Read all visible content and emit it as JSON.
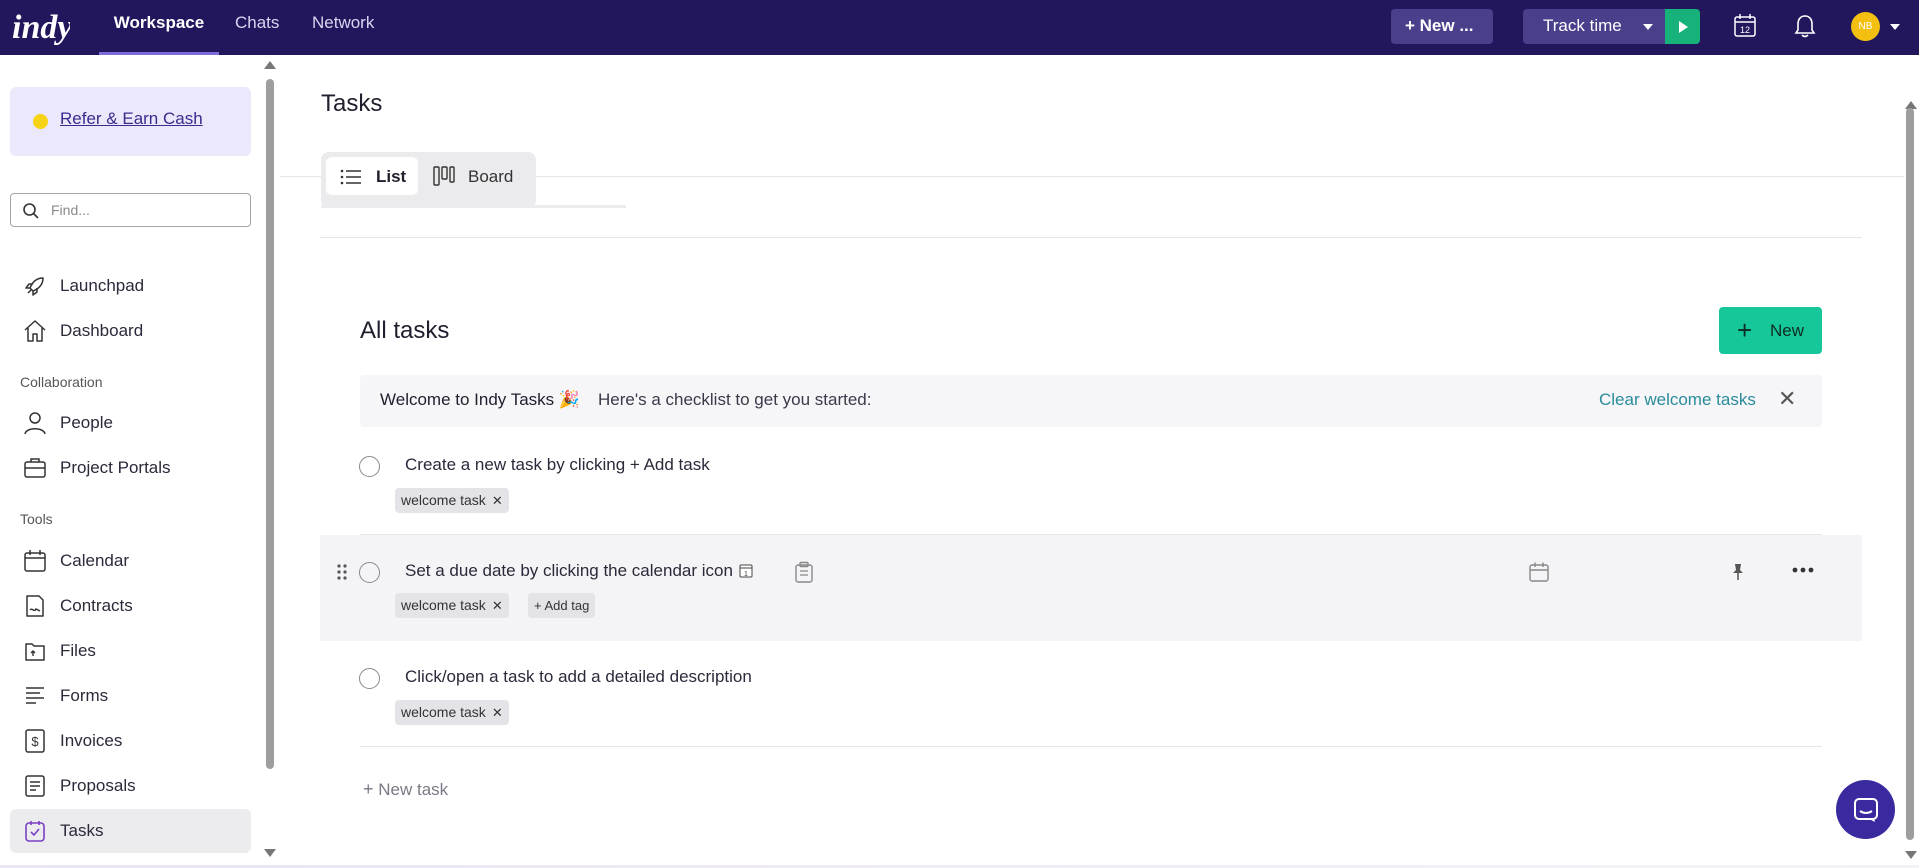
{
  "topbar": {
    "logo": "indy",
    "tabs": [
      {
        "label": "Workspace",
        "active": true
      },
      {
        "label": "Chats",
        "active": false
      },
      {
        "label": "Network",
        "active": false
      }
    ],
    "new_button": "+ New ...",
    "track_time": "Track time",
    "calendar_day": "12",
    "avatar_initials": "NB"
  },
  "sidebar": {
    "refer": "Refer & Earn Cash",
    "search_placeholder": "Find...",
    "items_top": [
      {
        "label": "Launchpad",
        "icon": "rocket-icon"
      },
      {
        "label": "Dashboard",
        "icon": "home-icon"
      }
    ],
    "section_collab": "Collaboration",
    "items_collab": [
      {
        "label": "People",
        "icon": "person-icon"
      },
      {
        "label": "Project Portals",
        "icon": "briefcase-icon"
      }
    ],
    "section_tools": "Tools",
    "items_tools": [
      {
        "label": "Calendar",
        "icon": "calendar-icon"
      },
      {
        "label": "Contracts",
        "icon": "contract-icon"
      },
      {
        "label": "Files",
        "icon": "file-icon"
      },
      {
        "label": "Forms",
        "icon": "form-icon"
      },
      {
        "label": "Invoices",
        "icon": "invoice-icon"
      },
      {
        "label": "Proposals",
        "icon": "proposal-icon"
      },
      {
        "label": "Tasks",
        "icon": "tasks-icon",
        "active": true
      }
    ]
  },
  "main": {
    "title": "Tasks",
    "view_toggle": {
      "list": "List",
      "board": "Board",
      "selected": "List"
    },
    "card_title": "All tasks",
    "new_button": "New",
    "welcome": {
      "title": "Welcome to Indy Tasks 🎉",
      "subtitle": "Here's a checklist to get you started:",
      "clear": "Clear welcome tasks"
    },
    "tasks": [
      {
        "title": "Create a new task by clicking + Add task",
        "tag": "welcome task"
      },
      {
        "title": "Set a due date by clicking the calendar icon",
        "tag": "welcome task",
        "add_tag": "+ Add tag"
      },
      {
        "title": "Click/open a task to add a detailed description",
        "tag": "welcome task"
      }
    ],
    "new_task": "New task"
  },
  "colors": {
    "topbar": "#22175c",
    "accent_green": "#16c79a",
    "refer_bg": "#ece8fb",
    "link_teal": "#2a8b9b"
  }
}
